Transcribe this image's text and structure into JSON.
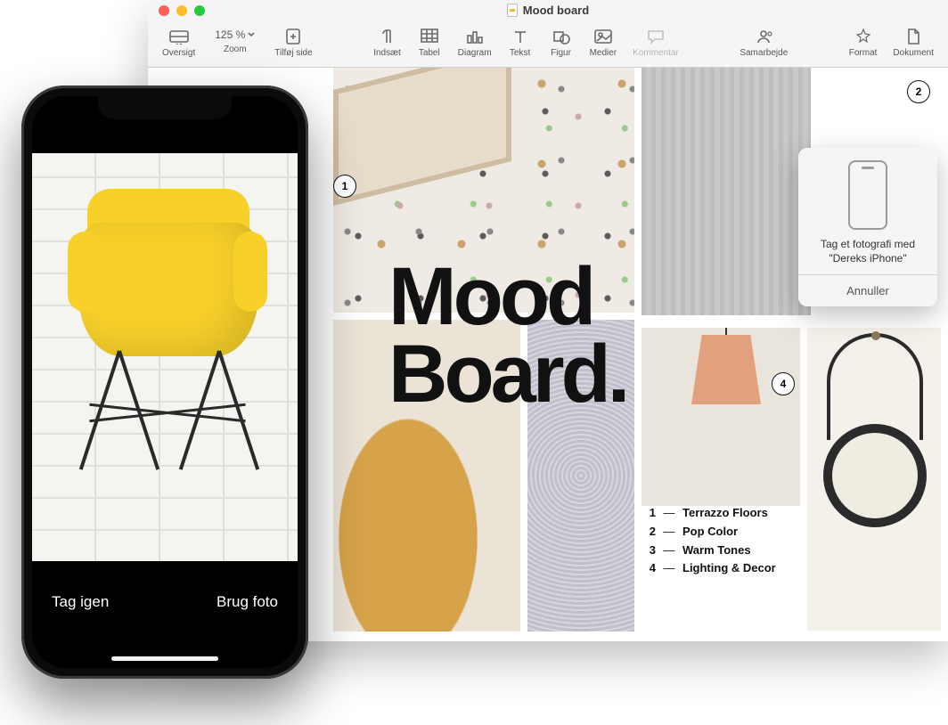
{
  "window": {
    "title": "Mood board"
  },
  "toolbar": {
    "view": "Oversigt",
    "zoom_value": "125 %",
    "zoom_label": "Zoom",
    "add_page": "Tilføj side",
    "insert": "Indsæt",
    "table": "Tabel",
    "chart": "Diagram",
    "text": "Tekst",
    "shape": "Figur",
    "media": "Medier",
    "comment": "Kommentar",
    "collaborate": "Samarbejde",
    "format": "Format",
    "document": "Dokument"
  },
  "document": {
    "heading_line1": "Mood",
    "heading_line2": "Board.",
    "legend": [
      {
        "n": "1",
        "label": "Terrazzo Floors"
      },
      {
        "n": "2",
        "label": "Pop Color"
      },
      {
        "n": "3",
        "label": "Warm Tones"
      },
      {
        "n": "4",
        "label": "Lighting & Decor"
      }
    ],
    "callouts": {
      "c1": "1",
      "c2": "2",
      "c4": "4"
    }
  },
  "popover": {
    "line1": "Tag et fotografi med",
    "line2": "\"Dereks iPhone\"",
    "cancel": "Annuller"
  },
  "iphone": {
    "retake": "Tag igen",
    "use": "Brug foto"
  }
}
